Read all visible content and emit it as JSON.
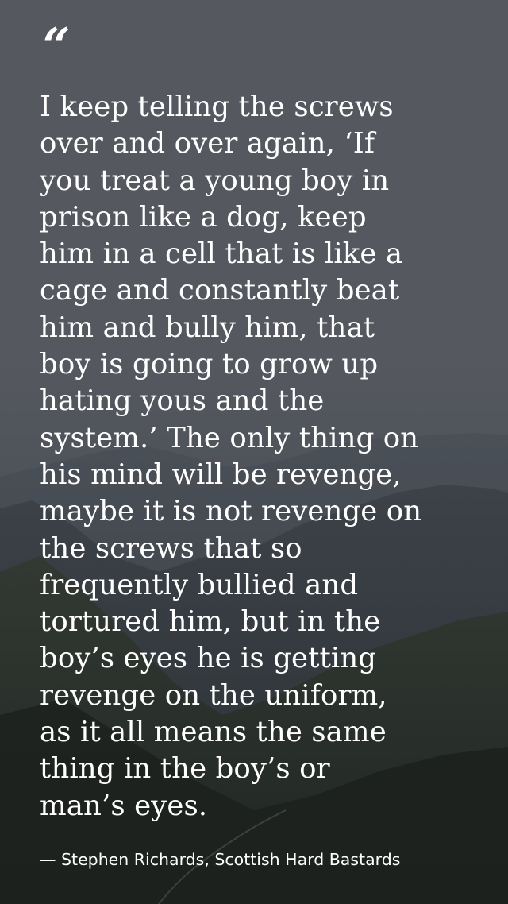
{
  "quote": {
    "mark": "“",
    "text": "I keep telling the screws\nover and over again, ‘If\nyou treat a young boy in\nprison like a dog, keep\nhim in a cell that is like a\ncage and constantly beat\nhim and bully him, that\nboy is going to grow up\nhating yous and the\nsystem.’ The only thing on\nhis mind will be revenge,\nmaybe it is not revenge on\nthe screws that so\nfrequently bullied and\ntortured him, but in the\nboy’s eyes he is getting\nrevenge on the uniform,\nas it all means the same\nthing in the boy’s or\nman’s eyes.",
    "attribution": "— Stephen Richards, Scottish Hard Bastards"
  },
  "colors": {
    "text": "#ffffff",
    "sky": "#55585e",
    "mountains": "#2e3337"
  },
  "icons": {
    "quote_mark": "quote-mark-icon"
  }
}
